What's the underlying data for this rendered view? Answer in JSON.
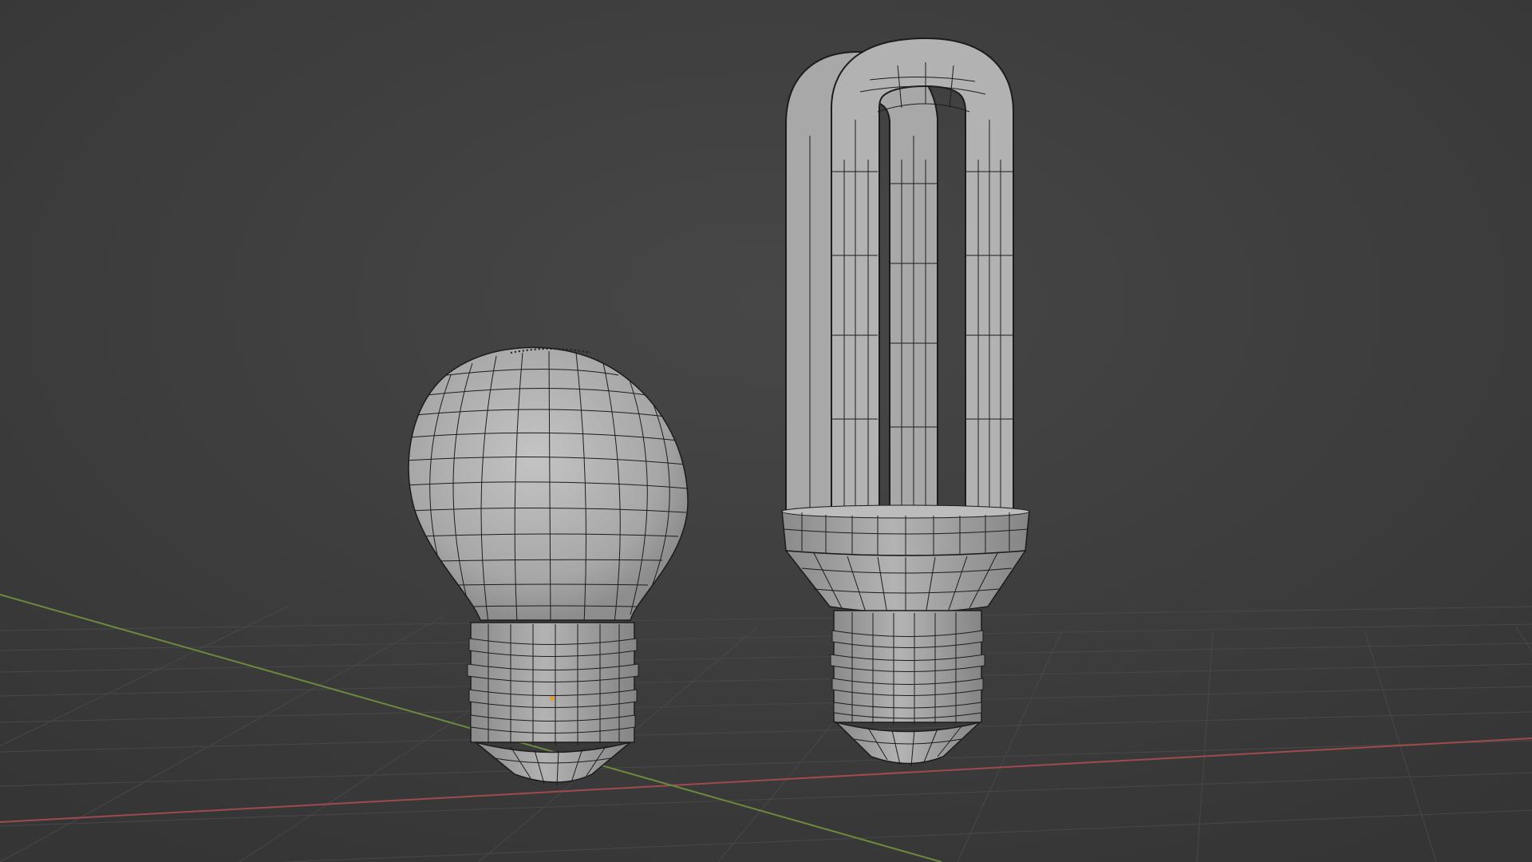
{
  "viewport": {
    "mode": "solid-shading-wireframe-overlay",
    "background_color": "#3d3d3d",
    "floor_grid": true,
    "axis_colors": {
      "x": "#a04a4f",
      "y": "#6c8a3c"
    }
  },
  "objects": [
    {
      "name": "incandescent-bulb",
      "type": "mesh",
      "material_color": "#a6a6a6",
      "selected_vertex": true
    },
    {
      "name": "cfl-bulb",
      "type": "mesh",
      "material_color": "#a6a6a6",
      "selected_vertex": false
    }
  ],
  "colors": {
    "wire": "#1c1c1c",
    "selected_vertex": "#e89b2a"
  }
}
